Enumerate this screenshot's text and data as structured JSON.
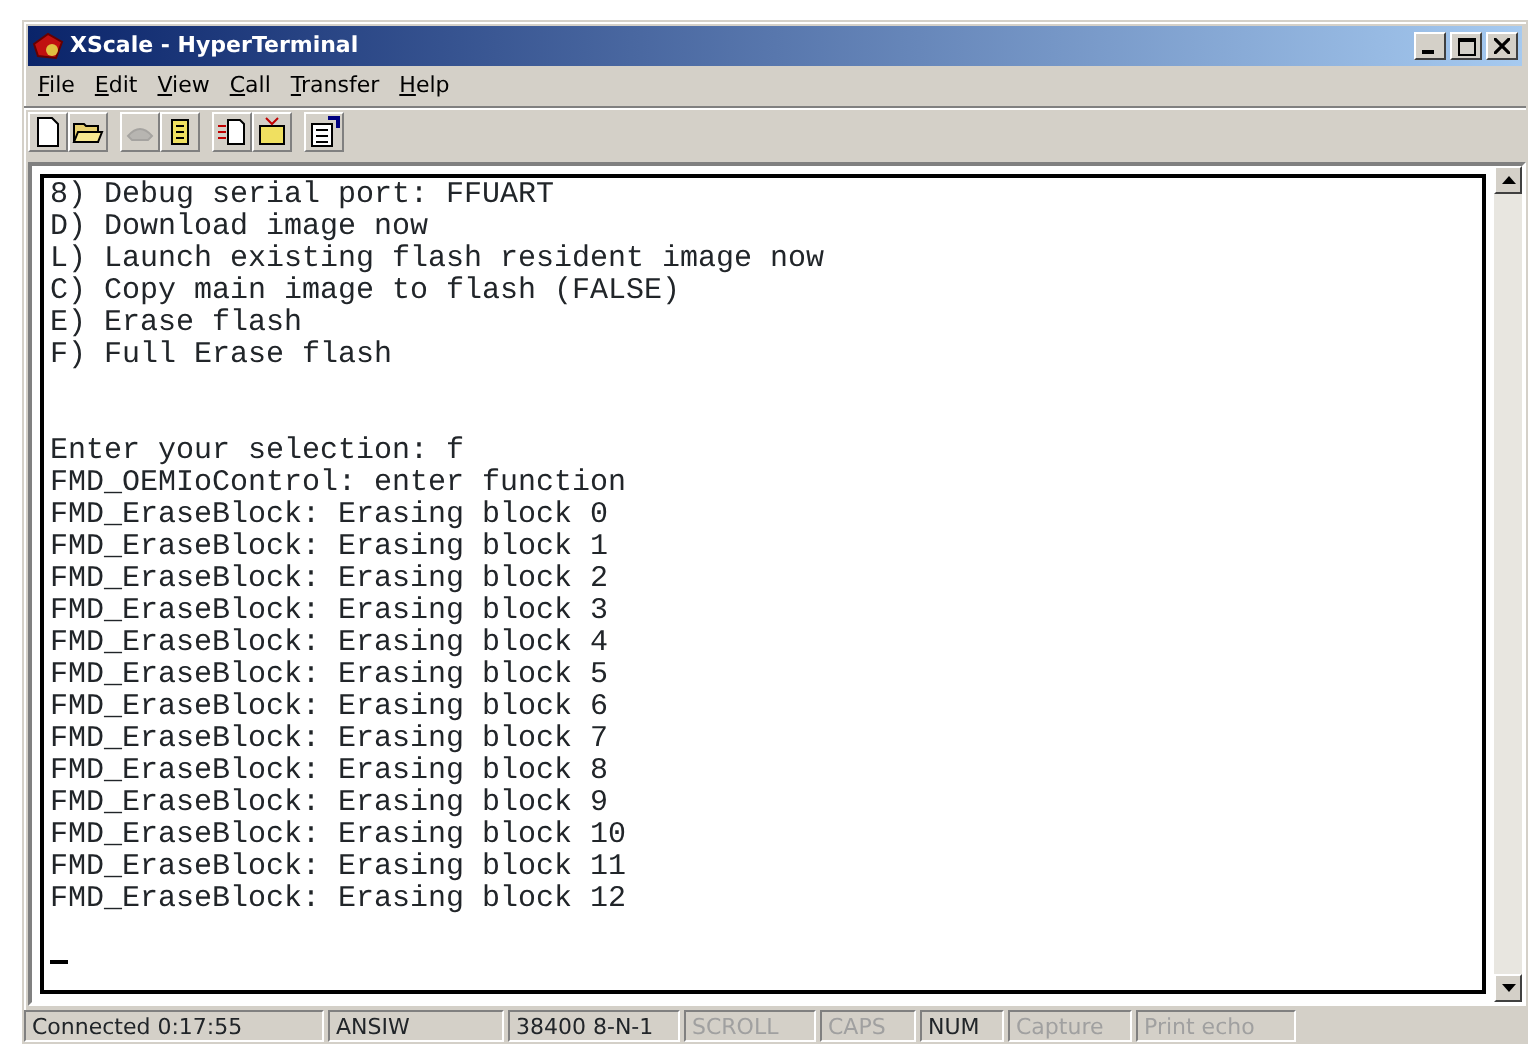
{
  "window": {
    "title": "XScale - HyperTerminal"
  },
  "menu": [
    "File",
    "Edit",
    "View",
    "Call",
    "Transfer",
    "Help"
  ],
  "toolbar": [
    {
      "kind": "new",
      "disabled": false
    },
    {
      "kind": "open",
      "disabled": false
    },
    {
      "kind": "sep"
    },
    {
      "kind": "disconnect",
      "disabled": true
    },
    {
      "kind": "dial",
      "disabled": false
    },
    {
      "kind": "sep"
    },
    {
      "kind": "send",
      "disabled": false
    },
    {
      "kind": "receive",
      "disabled": false
    },
    {
      "kind": "sep"
    },
    {
      "kind": "properties",
      "disabled": false
    }
  ],
  "terminal": {
    "lines": [
      {
        "kind": "text",
        "text": "8) Debug serial port: FFUART"
      },
      {
        "kind": "text",
        "text": "D) Download image now"
      },
      {
        "kind": "text",
        "text": "L) Launch existing flash resident image now"
      },
      {
        "kind": "text",
        "text": "C) Copy main image to flash (FALSE)"
      },
      {
        "kind": "text",
        "text": "E) Erase flash"
      },
      {
        "kind": "text",
        "text": "F) Full Erase flash"
      },
      {
        "kind": "gap"
      },
      {
        "kind": "gap"
      },
      {
        "kind": "text",
        "text": "Enter your selection: f"
      },
      {
        "kind": "text",
        "text": "FMD_OEMIoControl: enter function"
      },
      {
        "kind": "text",
        "text": "FMD_EraseBlock: Erasing block 0"
      },
      {
        "kind": "text",
        "text": "FMD_EraseBlock: Erasing block 1"
      },
      {
        "kind": "text",
        "text": "FMD_EraseBlock: Erasing block 2"
      },
      {
        "kind": "text",
        "text": "FMD_EraseBlock: Erasing block 3"
      },
      {
        "kind": "text",
        "text": "FMD_EraseBlock: Erasing block 4"
      },
      {
        "kind": "text",
        "text": "FMD_EraseBlock: Erasing block 5"
      },
      {
        "kind": "text",
        "text": "FMD_EraseBlock: Erasing block 6"
      },
      {
        "kind": "text",
        "text": "FMD_EraseBlock: Erasing block 7"
      },
      {
        "kind": "text",
        "text": "FMD_EraseBlock: Erasing block 8"
      },
      {
        "kind": "text",
        "text": "FMD_EraseBlock: Erasing block 9"
      },
      {
        "kind": "text",
        "text": "FMD_EraseBlock: Erasing block 10"
      },
      {
        "kind": "text",
        "text": "FMD_EraseBlock: Erasing block 11"
      },
      {
        "kind": "text",
        "text": "FMD_EraseBlock: Erasing block 12"
      },
      {
        "kind": "gap"
      },
      {
        "kind": "cursor"
      }
    ]
  },
  "status_bar": [
    {
      "text": "Connected 0:17:55",
      "active": true
    },
    {
      "text": "ANSIW",
      "active": true
    },
    {
      "text": "38400 8-N-1",
      "active": true
    },
    {
      "text": "SCROLL",
      "active": false
    },
    {
      "text": "CAPS",
      "active": false
    },
    {
      "text": "NUM",
      "active": true
    },
    {
      "text": "Capture",
      "active": false
    },
    {
      "text": "Print echo",
      "active": false
    }
  ]
}
